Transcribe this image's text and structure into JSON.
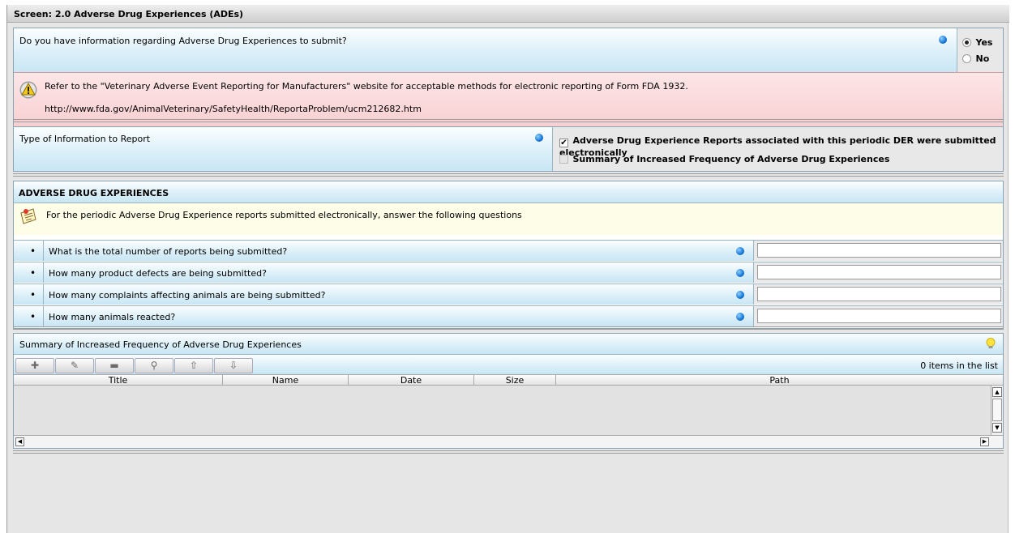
{
  "screen_title": "Screen: 2.0 Adverse Drug Experiences (ADEs)",
  "ade_question": {
    "text": "Do you have information regarding Adverse Drug Experiences to submit?",
    "options": [
      {
        "label": "Yes",
        "selected": true
      },
      {
        "label": "No",
        "selected": false
      }
    ]
  },
  "warning": {
    "text": "Refer to the \"Veterinary Adverse Event Reporting for Manufacturers\" website for acceptable methods for electronic reporting of Form FDA 1932.",
    "url": "http://www.fda.gov/AnimalVeterinary/SafetyHealth/ReportaProblem/ucm212682.htm"
  },
  "info_type": {
    "label": "Type of Information to Report",
    "options": [
      {
        "label": "Adverse Drug Experience Reports associated with this periodic DER were submitted electronically",
        "checked": true
      },
      {
        "label": "Summary of Increased Frequency of Adverse Drug Experiences",
        "checked": false
      }
    ]
  },
  "ade_section": {
    "header": "ADVERSE DRUG EXPERIENCES",
    "note": "For the periodic Adverse Drug Experience reports submitted electronically, answer the following questions",
    "questions": [
      {
        "text": "What is the total number of reports being submitted?",
        "value": ""
      },
      {
        "text": "How many product defects are being submitted?",
        "value": ""
      },
      {
        "text": "How many complaints affecting animals are being submitted?",
        "value": ""
      },
      {
        "text": "How many animals reacted?",
        "value": ""
      }
    ]
  },
  "summary_table": {
    "title": "Summary of Increased Frequency of Adverse Drug Experiences",
    "count_text": "0 items in the list",
    "columns": [
      "Title",
      "Name",
      "Date",
      "Size",
      "Path"
    ],
    "toolbar_icons": [
      "add-icon",
      "edit-icon",
      "remove-icon",
      "search-icon",
      "move-up-icon",
      "move-down-icon"
    ]
  },
  "colors": {
    "panel_blue": "#d9eef8",
    "warning_pink": "#fbd7d9",
    "note_yellow": "#fdfde8",
    "required_dot": "#1476d6"
  }
}
